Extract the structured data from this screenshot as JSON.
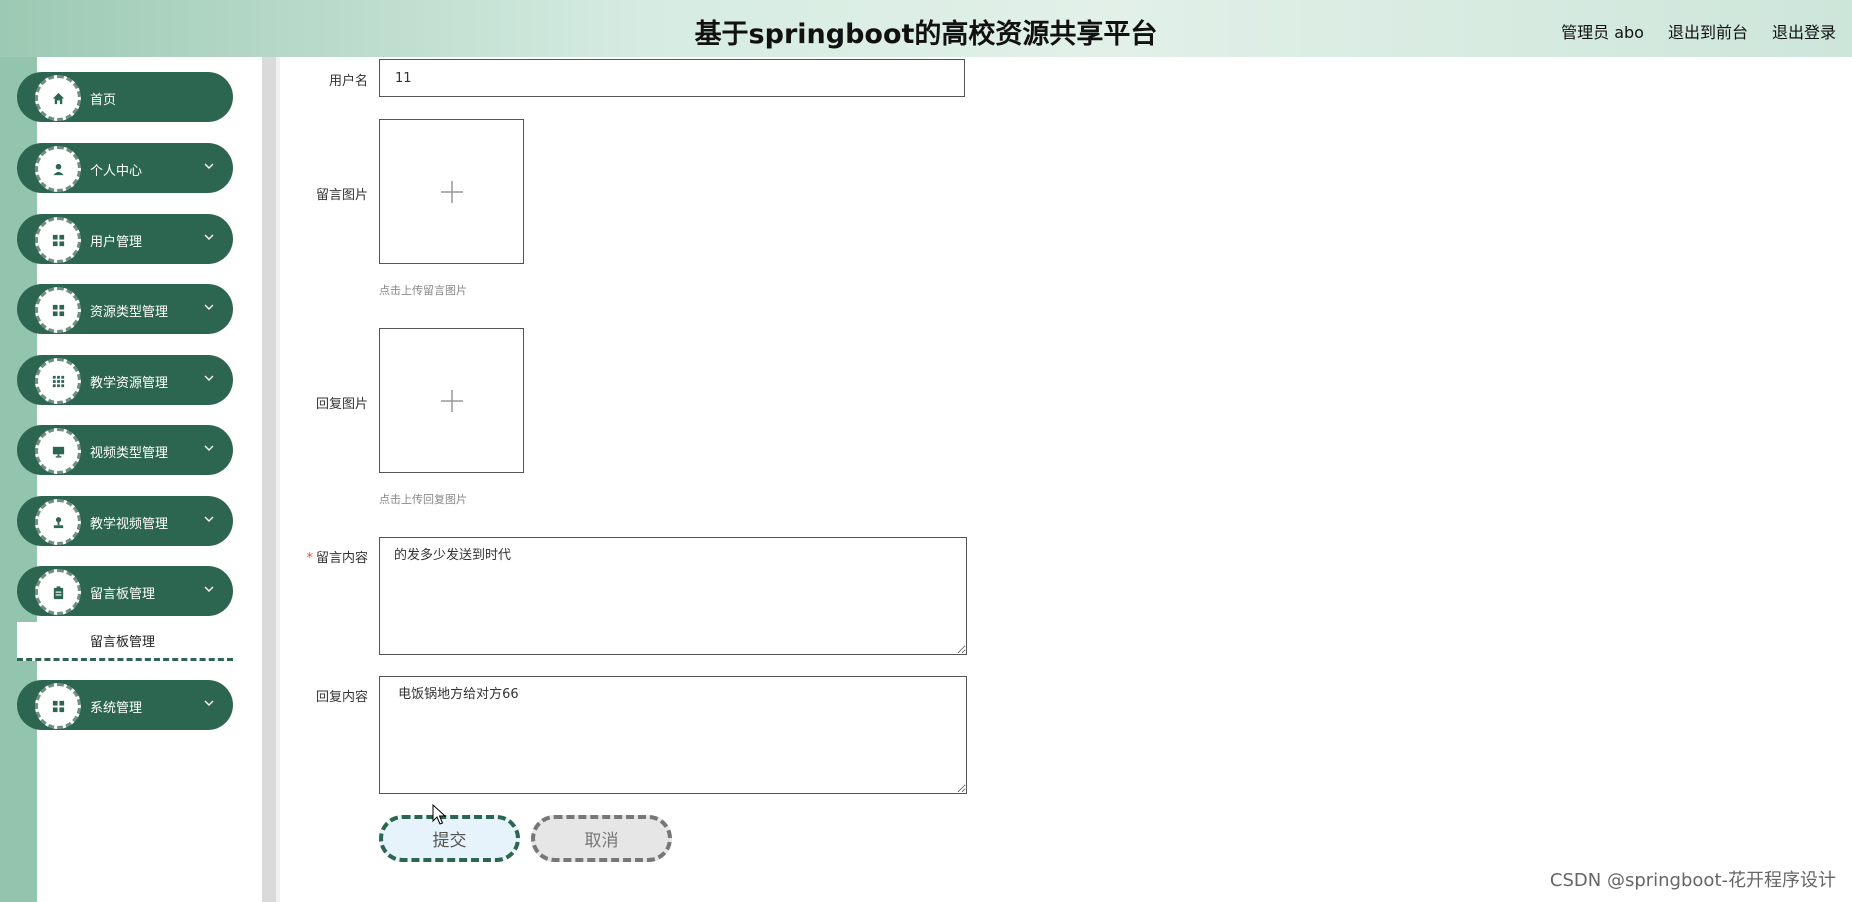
{
  "header": {
    "title": "基于springboot的高校资源共享平台",
    "user_role": "管理员 abo",
    "back_to_front": "退出到前台",
    "logout": "退出登录"
  },
  "sidebar": {
    "items": [
      {
        "label": "首页",
        "icon": "home-icon"
      },
      {
        "label": "个人中心",
        "icon": "user-icon"
      },
      {
        "label": "用户管理",
        "icon": "grid-icon"
      },
      {
        "label": "资源类型管理",
        "icon": "grid-icon"
      },
      {
        "label": "教学资源管理",
        "icon": "apps-icon"
      },
      {
        "label": "视频类型管理",
        "icon": "monitor-icon"
      },
      {
        "label": "教学视频管理",
        "icon": "stamp-icon"
      },
      {
        "label": "留言板管理",
        "icon": "clipboard-icon"
      },
      {
        "label": "系统管理",
        "icon": "grid-icon"
      }
    ],
    "submenu_label": "留言板管理"
  },
  "form": {
    "username_label": "用户名",
    "username_value": "11",
    "message_image_label": "留言图片",
    "message_image_hint": "点击上传留言图片",
    "reply_image_label": "回复图片",
    "reply_image_hint": "点击上传回复图片",
    "message_content_label": "留言内容",
    "message_content_value": "的发多少发送到时代",
    "reply_content_label": "回复内容",
    "reply_content_value": " 电饭锅地方给对方66",
    "submit_label": "提交",
    "cancel_label": "取消"
  },
  "watermark": "CSDN @springboot-花开程序设计",
  "colors": {
    "menu_bg": "#2d6650",
    "sidebar_strip": "#93c4ad",
    "required_star": "#e74c3c"
  }
}
